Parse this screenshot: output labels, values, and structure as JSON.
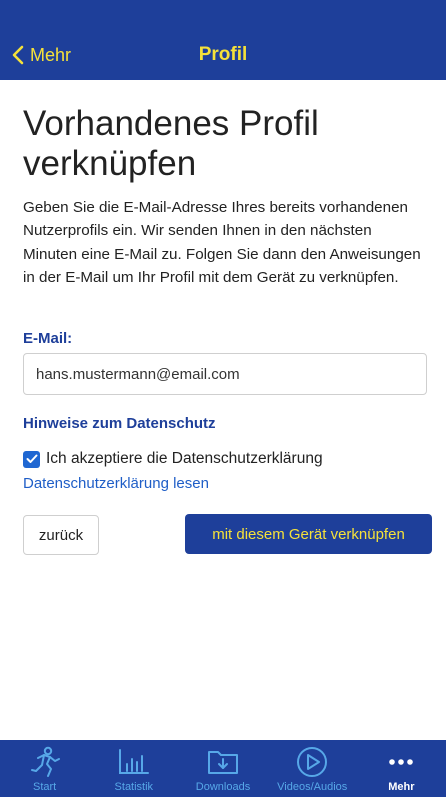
{
  "nav": {
    "back_label": "Mehr",
    "title": "Profil"
  },
  "page": {
    "title": "Vorhandenes Profil verknüpfen",
    "description": "Geben Sie die E-Mail-Adresse Ihres bereits vorhandenen Nutzerprofils ein. Wir senden Ihnen in den nächsten Minuten eine E-Mail zu. Folgen Sie dann den Anweisungen in der E-Mail um Ihr Profil mit dem Gerät zu verknüpfen."
  },
  "form": {
    "email_label": "E-Mail:",
    "email_value": "hans.mustermann@email.com",
    "privacy_heading": "Hinweise zum Datenschutz",
    "consent_label": "Ich akzeptiere die Datenschutzerklärung",
    "consent_checked": true,
    "privacy_link": "Datenschutzerklärung lesen",
    "back_button": "zurück",
    "submit_button": "mit diesem Gerät verknüpfen"
  },
  "tabbar": {
    "items": [
      {
        "label": "Start",
        "icon": "runner-icon"
      },
      {
        "label": "Statistik",
        "icon": "bar-chart-icon"
      },
      {
        "label": "Downloads",
        "icon": "download-folder-icon"
      },
      {
        "label": "Videos/Audios",
        "icon": "play-icon"
      },
      {
        "label": "Mehr",
        "icon": "more-dots-icon",
        "active": true
      }
    ]
  },
  "colors": {
    "primary": "#1e3f9a",
    "accent": "#f5e13a",
    "tab_inactive": "#57a8e8",
    "link": "#1f5ec7"
  }
}
